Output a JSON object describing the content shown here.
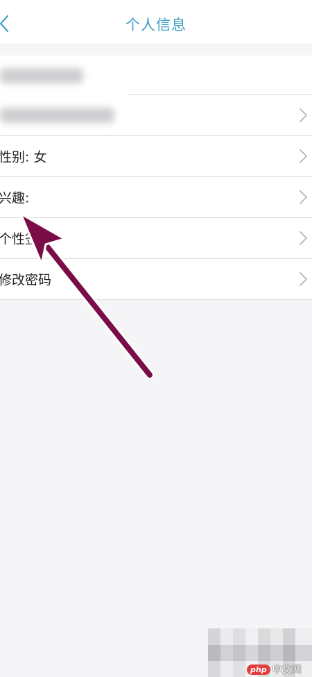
{
  "header": {
    "title": "个人信息",
    "back_icon": "chevron-left-icon"
  },
  "list": {
    "rows": [
      {
        "label": "",
        "redacted": true
      },
      {
        "label": "",
        "redacted": true
      },
      {
        "label": "性别: 女"
      },
      {
        "label": "兴趣:"
      },
      {
        "label": "个性签"
      },
      {
        "label": "修改密码"
      }
    ],
    "chevron_icon": "chevron-right-icon"
  },
  "annotation": {
    "arrow_color": "#7a0a47"
  },
  "watermark": {
    "badge": "php",
    "site": "中文网"
  },
  "colors": {
    "title": "#3f9fc6",
    "background": "#f5f5f7",
    "divider": "#dcdcdc"
  }
}
